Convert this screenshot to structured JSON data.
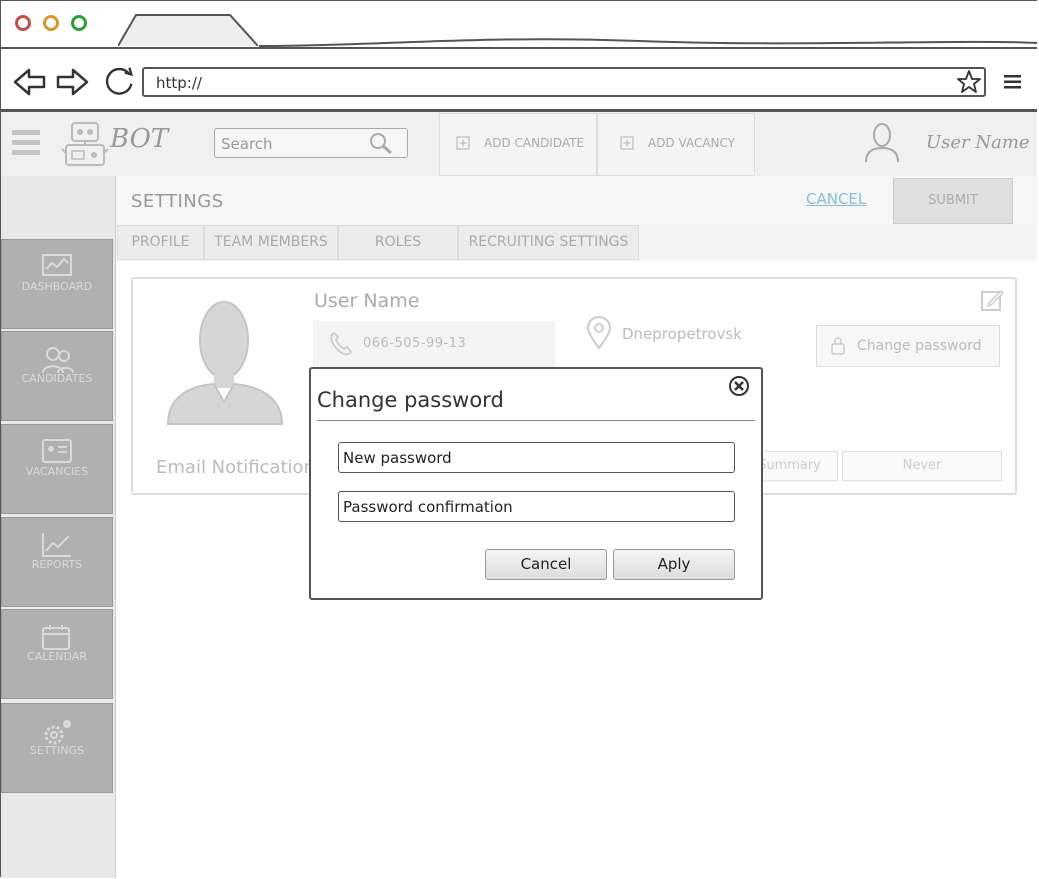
{
  "browser": {
    "url": "http://",
    "window_buttons": {
      "close_color": "#c0504d",
      "minimize_color": "#d9952b",
      "maximize_color": "#2f9e3a"
    }
  },
  "app": {
    "logo_text": "BOT",
    "search_placeholder": "Search",
    "header_buttons": [
      {
        "label": "ADD CANDIDATE",
        "icon": "plus-square-icon"
      },
      {
        "label": "ADD VACANCY",
        "icon": "plus-square-icon"
      }
    ],
    "user_name": "User Name"
  },
  "sidebar": {
    "items": [
      {
        "label": "DASHBOARD",
        "icon": "dashboard-icon"
      },
      {
        "label": "CANDIDATES",
        "icon": "candidates-icon"
      },
      {
        "label": "VACANCIES",
        "icon": "vacancies-icon"
      },
      {
        "label": "REPORTS",
        "icon": "reports-icon"
      },
      {
        "label": "CALENDAR",
        "icon": "calendar-icon"
      },
      {
        "label": "SETTINGS",
        "icon": "settings-icon"
      }
    ]
  },
  "settings": {
    "title": "SETTINGS",
    "cancel_label": "CANCEL",
    "submit_label": "SUBMIT",
    "tabs": [
      {
        "label": "PROFILE"
      },
      {
        "label": "TEAM MEMBERS"
      },
      {
        "label": "ROLES"
      },
      {
        "label": "RECRUITING SETTINGS"
      }
    ]
  },
  "profile": {
    "user_name": "User Name",
    "phone": "066-505-99-13",
    "city": "Dnepropetrovsk",
    "change_password_label": "Change password",
    "email_notifications_label": "Email Notifications",
    "notification_options": [
      "Summary",
      "Never"
    ]
  },
  "modal": {
    "title": "Change password",
    "new_password_placeholder": "New password",
    "confirmation_placeholder": "Password confirmation",
    "cancel_label": "Cancel",
    "apply_label": "Aply"
  }
}
